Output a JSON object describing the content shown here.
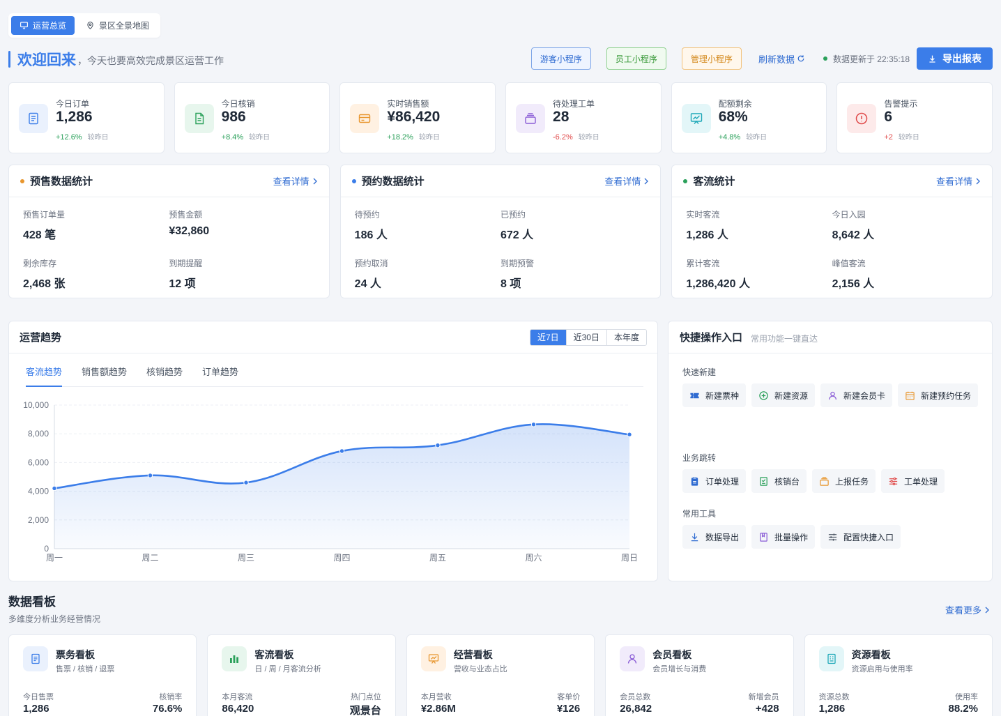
{
  "tabs": [
    {
      "label": "运营总览",
      "icon": "monitor-icon",
      "active": true
    },
    {
      "label": "景区全景地图",
      "icon": "map-pin-icon",
      "active": false
    }
  ],
  "welcome": {
    "title": "欢迎回来",
    "subtitle": "，今天也要高效完成景区运营工作"
  },
  "header": {
    "mini_programs": [
      "游客小程序",
      "员工小程序",
      "管理小程序"
    ],
    "refresh_label": "刷新数据",
    "updated_text": "数据更新于 22:35:18",
    "export_label": "导出报表"
  },
  "stats": [
    {
      "label": "今日订单",
      "value": "1,286",
      "change": "+12.6%",
      "trend": "up",
      "compare": "较昨日",
      "icon": "document-icon",
      "color": "#3b7de9",
      "bg": "#eaf1fd"
    },
    {
      "label": "今日核销",
      "value": "986",
      "change": "+8.4%",
      "trend": "up",
      "compare": "较昨日",
      "icon": "file-text-icon",
      "color": "#2aa05a",
      "bg": "#e7f6ed"
    },
    {
      "label": "实时销售额",
      "value": "¥86,420",
      "change": "+18.2%",
      "trend": "up",
      "compare": "较昨日",
      "icon": "card-icon",
      "color": "#e8962e",
      "bg": "#fff1e2"
    },
    {
      "label": "待处理工单",
      "value": "28",
      "change": "-6.2%",
      "trend": "down",
      "compare": "较昨日",
      "icon": "inbox-icon",
      "color": "#8a5cd6",
      "bg": "#f1ebfb"
    },
    {
      "label": "配额剩余",
      "value": "68%",
      "change": "+4.8%",
      "trend": "up",
      "compare": "较昨日",
      "icon": "chart-board-icon",
      "color": "#1ea8b8",
      "bg": "#e3f6f8"
    },
    {
      "label": "告警提示",
      "value": "6",
      "change": "+2",
      "trend": "down",
      "compare": "较昨日",
      "icon": "alert-circle-icon",
      "color": "#e04b4b",
      "bg": "#fdeaea"
    }
  ],
  "panels": [
    {
      "title": "预售数据统计",
      "dot": "#e8962e",
      "more": "查看详情",
      "items": [
        {
          "k": "预售订单量",
          "v": "428 笔"
        },
        {
          "k": "预售金额",
          "v": "¥32,860"
        },
        {
          "k": "剩余库存",
          "v": "2,468 张"
        },
        {
          "k": "到期提醒",
          "v": "12 项"
        }
      ]
    },
    {
      "title": "预约数据统计",
      "dot": "#3b7de9",
      "more": "查看详情",
      "items": [
        {
          "k": "待预约",
          "v": "186 人"
        },
        {
          "k": "已预约",
          "v": "672 人"
        },
        {
          "k": "预约取消",
          "v": "24 人"
        },
        {
          "k": "到期预警",
          "v": "8 项"
        }
      ]
    },
    {
      "title": "客流统计",
      "dot": "#2aa05a",
      "more": "查看详情",
      "items": [
        {
          "k": "实时客流",
          "v": "1,286 人"
        },
        {
          "k": "今日入园",
          "v": "8,642 人"
        },
        {
          "k": "累计客流",
          "v": "1,286,420 人"
        },
        {
          "k": "峰值客流",
          "v": "2,156 人"
        }
      ]
    }
  ],
  "trend": {
    "title": "运营趋势",
    "ranges": [
      "近7日",
      "近30日",
      "本年度"
    ],
    "active_range": 0,
    "subtabs": [
      "客流趋势",
      "销售额趋势",
      "核销趋势",
      "订单趋势"
    ],
    "active_subtab": 0
  },
  "chart_data": {
    "type": "area",
    "categories": [
      "周一",
      "周二",
      "周三",
      "周四",
      "周五",
      "周六",
      "周日"
    ],
    "values": [
      4200,
      5100,
      4600,
      6800,
      7200,
      8650,
      7950
    ],
    "ylim": [
      0,
      10000
    ],
    "yticks": [
      "0",
      "2,000",
      "4,000",
      "6,000",
      "8,000",
      "10,000"
    ],
    "grid": true,
    "color": "#3b7de9"
  },
  "quick": {
    "title": "快捷操作入口",
    "subtitle": "常用功能一键直达",
    "sections": [
      {
        "title": "快速新建",
        "items": [
          {
            "label": "新建票种",
            "icon": "ticket-icon",
            "color": "#2f6bd1"
          },
          {
            "label": "新建资源",
            "icon": "plus-circle-icon",
            "color": "#2aa05a"
          },
          {
            "label": "新建会员卡",
            "icon": "user-icon",
            "color": "#8a5cd6"
          },
          {
            "label": "新建预约任务",
            "icon": "calendar-icon",
            "color": "#e8962e"
          }
        ]
      },
      {
        "title": "业务跳转",
        "items": [
          {
            "label": "订单处理",
            "icon": "clipboard-icon",
            "color": "#2f6bd1"
          },
          {
            "label": "核销台",
            "icon": "verify-icon",
            "color": "#2aa05a"
          },
          {
            "label": "上报任务",
            "icon": "folder-icon",
            "color": "#e8962e"
          },
          {
            "label": "工单处理",
            "icon": "sliders-icon",
            "color": "#e04b4b"
          }
        ]
      },
      {
        "title": "常用工具",
        "items": [
          {
            "label": "数据导出",
            "icon": "download-icon",
            "color": "#2f6bd1"
          },
          {
            "label": "批量操作",
            "icon": "bookmark-icon",
            "color": "#8a5cd6"
          },
          {
            "label": "配置快捷入口",
            "icon": "settings-sliders-icon",
            "color": "#4b5563"
          }
        ]
      }
    ]
  },
  "board": {
    "title": "数据看板",
    "subtitle": "多维度分析业务经营情况",
    "more": "查看更多",
    "cards": [
      {
        "name": "票务看板",
        "desc": "售票 / 核销 / 退票",
        "k1": "今日售票",
        "v1": "1,286",
        "k2": "核销率",
        "v2": "76.6%",
        "icon": "ticket-doc-icon",
        "color": "#3b7de9",
        "bg": "#eaf1fd"
      },
      {
        "name": "客流看板",
        "desc": "日 / 周 / 月客流分析",
        "k1": "本月客流",
        "v1": "86,420",
        "k2": "热门点位",
        "v2": "观景台",
        "icon": "bar-chart-icon",
        "color": "#2aa05a",
        "bg": "#e7f6ed"
      },
      {
        "name": "经营看板",
        "desc": "营收与业态占比",
        "k1": "本月营收",
        "v1": "¥2.86M",
        "k2": "客单价",
        "v2": "¥126",
        "icon": "presentation-icon",
        "color": "#e8962e",
        "bg": "#fff1e2"
      },
      {
        "name": "会员看板",
        "desc": "会员增长与消费",
        "k1": "会员总数",
        "v1": "26,842",
        "k2": "新增会员",
        "v2": "+428",
        "icon": "user-icon",
        "color": "#8a5cd6",
        "bg": "#f1ebfb"
      },
      {
        "name": "资源看板",
        "desc": "资源启用与使用率",
        "k1": "资源总数",
        "v1": "1,286",
        "k2": "使用率",
        "v2": "88.2%",
        "icon": "building-doc-icon",
        "color": "#1ea8b8",
        "bg": "#e3f6f8"
      }
    ]
  }
}
